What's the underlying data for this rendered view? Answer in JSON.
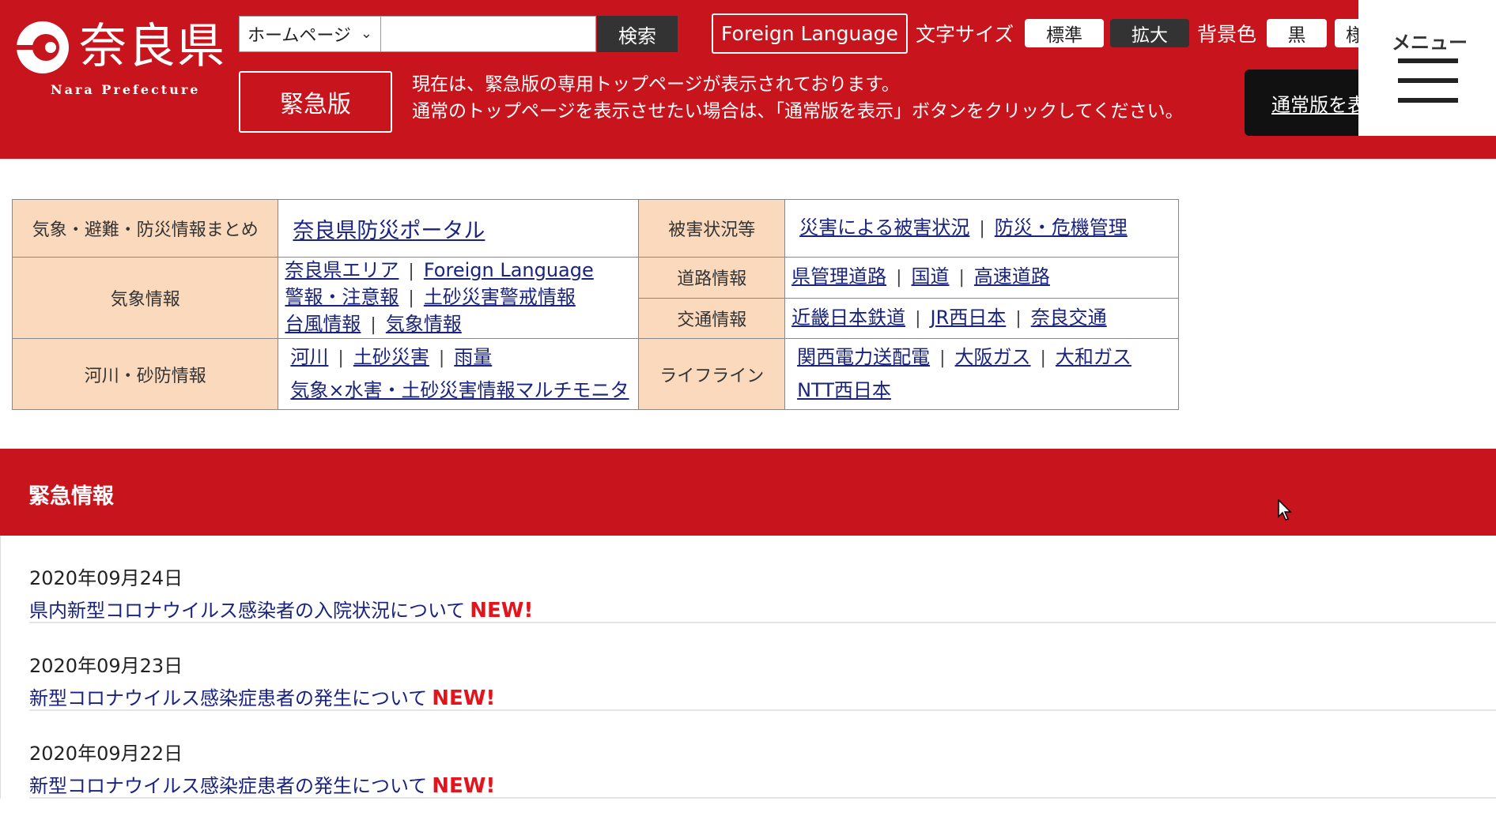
{
  "header": {
    "logo": {
      "name": "奈良県",
      "roman": "Nara Prefecture"
    },
    "search": {
      "select_value": "ホームページ",
      "placeholder": "",
      "button": "検索"
    },
    "foreign_language": "Foreign Language",
    "font_size": {
      "label": "文字サイズ",
      "standard": "標準",
      "large": "拡大"
    },
    "background": {
      "label": "背景色",
      "black": "黒",
      "next": "様"
    },
    "emergency_version": "緊急版",
    "emergency_message": [
      "現在は、緊急版の専用トップページが表示されております。",
      "通常のトップページを表示させたい場合は、「通常版を表示」ボタンをクリックしてください。"
    ],
    "normal_button": "通常版を表示",
    "menu_label": "メニュー"
  },
  "info_table": {
    "r1": {
      "cat": "気象・避難・防災情報まとめ",
      "portal": "奈良県防災ポータル",
      "cat2": "被害状況等",
      "links2": [
        "災害による被害状況",
        "防災・危機管理"
      ]
    },
    "r2": {
      "cat": "気象情報",
      "line1": [
        "奈良県エリア",
        "Foreign Language"
      ],
      "line2": [
        "警報・注意報",
        "土砂災害警戒情報"
      ],
      "line3": [
        "台風情報",
        "気象情報"
      ],
      "road_cat": "道路情報",
      "road_links": [
        "県管理道路",
        "国道",
        "高速道路"
      ],
      "traffic_cat": "交通情報",
      "traffic_links": [
        "近畿日本鉄道",
        "JR西日本",
        "奈良交通"
      ]
    },
    "r3": {
      "cat": "河川・砂防情報",
      "line1": [
        "河川",
        "土砂災害",
        "雨量"
      ],
      "line2": "気象×水害・土砂災害情報マルチモニタ",
      "lifeline_cat": "ライフライン",
      "lifeline_line1": [
        "関西電力送配電",
        "大阪ガス",
        "大和ガス"
      ],
      "lifeline_line2": "NTT西日本"
    }
  },
  "emergency_section": {
    "title": "緊急情報",
    "items": [
      {
        "date": "2020年09月24日",
        "title": "県内新型コロナウイルス感染者の入院状況について",
        "badge": "NEW!"
      },
      {
        "date": "2020年09月23日",
        "title": "新型コロナウイルス感染症患者の発生について",
        "badge": "NEW!"
      },
      {
        "date": "2020年09月22日",
        "title": "新型コロナウイルス感染症患者の発生について",
        "badge": "NEW!"
      }
    ]
  },
  "colors": {
    "brand_red": "#c8141c",
    "table_category_bg": "#fbd9bd",
    "link": "#1a237e",
    "new_badge": "#e3141c"
  }
}
